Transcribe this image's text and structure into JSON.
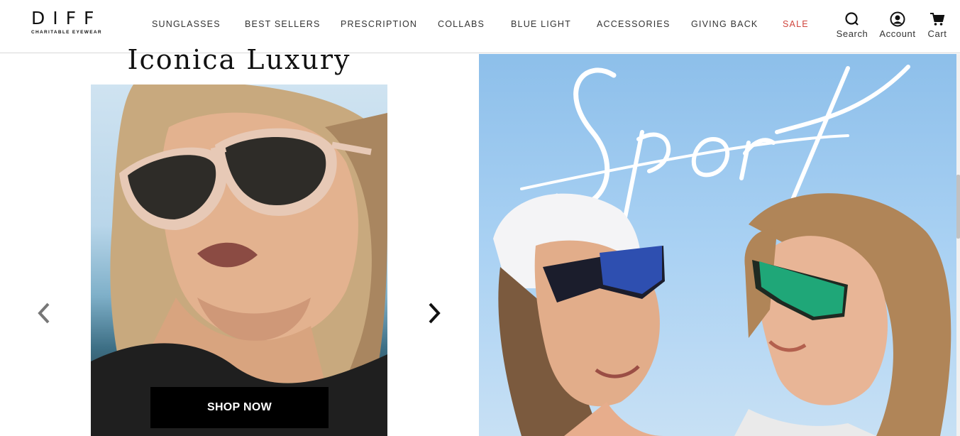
{
  "brand": {
    "name": "DIFF",
    "tagline": "CHARITABLE EYEWEAR"
  },
  "nav": {
    "items": [
      {
        "label": "SUNGLASSES"
      },
      {
        "label": "BEST SELLERS"
      },
      {
        "label": "PRESCRIPTION"
      },
      {
        "label": "COLLABS"
      },
      {
        "label": "BLUE LIGHT"
      },
      {
        "label": "ACCESSORIES"
      },
      {
        "label": "GIVING BACK"
      },
      {
        "label": "SALE"
      }
    ]
  },
  "utility": {
    "search": "Search",
    "account": "Account",
    "cart": "Cart"
  },
  "carousel": {
    "title": "Iconica Luxury",
    "cta": "SHOP NOW"
  },
  "banner": {
    "headline": "Sport"
  },
  "colors": {
    "sale": "#d0453d",
    "cta_bg": "#000000"
  }
}
